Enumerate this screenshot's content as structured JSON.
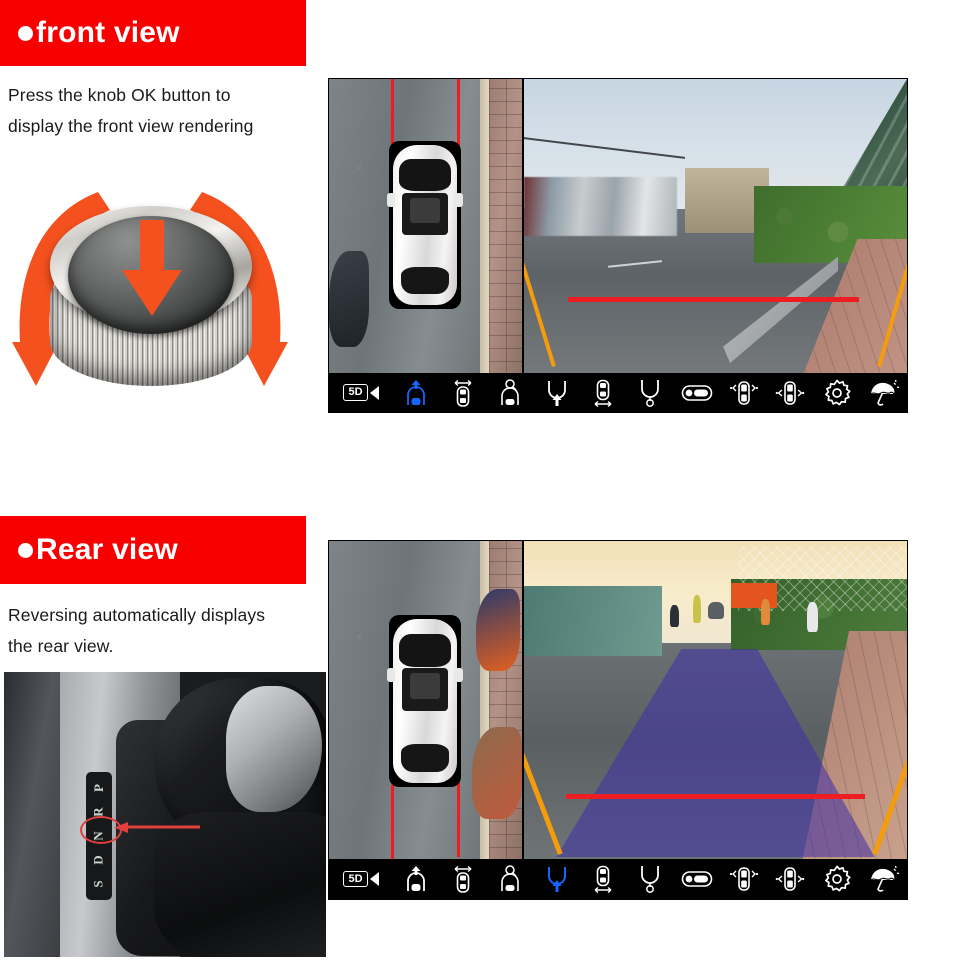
{
  "sections": [
    {
      "id": "front",
      "banner_title": "front view",
      "caption_lines": [
        "Press the knob OK button to",
        "display the front view rendering"
      ],
      "figure_name": "rotary-knob-illustration",
      "camera_ui": {
        "badge_text": "5D",
        "left_view": "bird-eye-top-down-view",
        "right_view": "front-camera-live-view",
        "active_icon_index": 1,
        "icons": [
          {
            "name": "camera-mode-badge",
            "label": "5D"
          },
          {
            "name": "front-view-icon",
            "label": "Front view"
          },
          {
            "name": "top-view-icon",
            "label": "Top view"
          },
          {
            "name": "front-zoom-view-icon",
            "label": "Front zoom view"
          },
          {
            "name": "rear-view-icon",
            "label": "Rear view"
          },
          {
            "name": "side-view-icon",
            "label": "Side view"
          },
          {
            "name": "rear-zoom-view-icon",
            "label": "Rear zoom view"
          },
          {
            "name": "wide-view-icon",
            "label": "Wide view"
          },
          {
            "name": "left-right-split-icon",
            "label": "Left right split view"
          },
          {
            "name": "side-mirror-view-icon",
            "label": "Side mirror view"
          },
          {
            "name": "settings-gear-icon",
            "label": "Settings"
          },
          {
            "name": "umbrella-rain-icon",
            "label": "Rain / wash mode"
          }
        ]
      }
    },
    {
      "id": "rear",
      "banner_title": "Rear view",
      "caption_lines": [
        "Reversing automatically displays",
        "the rear view."
      ],
      "figure_name": "gear-shifter-photo",
      "gear_positions": [
        "P",
        "R",
        "N",
        "D",
        "S"
      ],
      "highlighted_gear": "R",
      "camera_ui": {
        "badge_text": "5D",
        "left_view": "bird-eye-top-down-view",
        "right_view": "rear-camera-live-view",
        "active_icon_index": 4,
        "icons": [
          {
            "name": "camera-mode-badge",
            "label": "5D"
          },
          {
            "name": "front-view-icon",
            "label": "Front view"
          },
          {
            "name": "top-view-icon",
            "label": "Top view"
          },
          {
            "name": "front-zoom-view-icon",
            "label": "Front zoom view"
          },
          {
            "name": "rear-view-icon",
            "label": "Rear view"
          },
          {
            "name": "side-view-icon",
            "label": "Side view"
          },
          {
            "name": "rear-zoom-view-icon",
            "label": "Rear zoom view"
          },
          {
            "name": "wide-view-icon",
            "label": "Wide view"
          },
          {
            "name": "left-right-split-icon",
            "label": "Left right split view"
          },
          {
            "name": "side-mirror-view-icon",
            "label": "Side mirror view"
          },
          {
            "name": "settings-gear-icon",
            "label": "Settings"
          },
          {
            "name": "umbrella-rain-icon",
            "label": "Rain / wash mode"
          }
        ]
      }
    }
  ],
  "colors": {
    "banner_red": "#f80000",
    "guide_orange": "#f59c0a",
    "guide_stop_red": "#ee1d21",
    "active_icon_blue": "#1565ff",
    "knob_arrow_orange": "#f4511e",
    "rear_overlay_purple": "#3e2ea8",
    "toolbar_bg": "#000000",
    "page_bg": "#ffffff"
  }
}
